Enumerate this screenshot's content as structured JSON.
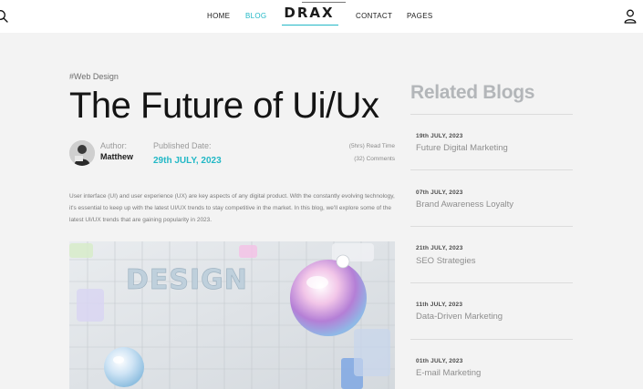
{
  "nav": {
    "home": "HOME",
    "blog": "BLOG",
    "logo": "DRAX",
    "contact": "CONTACT",
    "pages": "PAGES"
  },
  "article": {
    "tag": "#Web Design",
    "title": "The Future of Ui/Ux",
    "author_label": "Author:",
    "author_name": "Matthew",
    "published_label": "Published Date:",
    "published_date": "29th JULY, 2023",
    "read_time": "(5hrs) Read Time",
    "comments": "(32) Comments",
    "intro": "User interface (UI) and user experience (UX) are key aspects of any digital product. With the constantly evolving technology, it's essential to keep up with the latest UI/UX trends to stay competitive in the market. In this blog, we'll explore some of the latest UI/UX trends that are gaining popularity in 2023.",
    "hero_text": "DESIGN"
  },
  "related": {
    "title": "Related Blogs",
    "items": [
      {
        "date": "19th JULY, 2023",
        "title": "Future Digital Marketing"
      },
      {
        "date": "07th JULY, 2023",
        "title": "Brand Awareness Loyalty"
      },
      {
        "date": "21th JULY, 2023",
        "title": "SEO Strategies"
      },
      {
        "date": "11th JULY, 2023",
        "title": "Data-Driven Marketing"
      },
      {
        "date": "01th JULY, 2023",
        "title": "E-mail Marketing"
      }
    ]
  },
  "colors": {
    "accent": "#22b8c6",
    "background": "#f3f3f3",
    "text": "#141414",
    "muted": "#8e8e8e"
  }
}
